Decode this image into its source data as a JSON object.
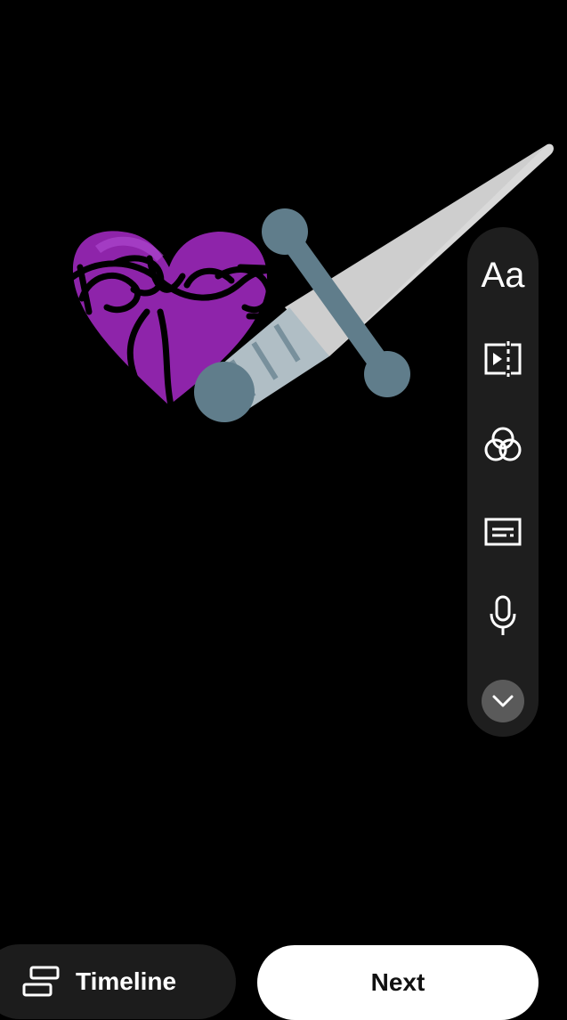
{
  "editor": {
    "sticker": {
      "icon": "purple-heart-barbed-wire-dagger",
      "heart_color": "#8e24aa",
      "blade_color": "#dcdcdc",
      "hilt_color": "#607d8b"
    }
  },
  "side_toolbar": {
    "text_tool_label": "Aa",
    "items": [
      {
        "name": "text-tool",
        "icon": "text-icon"
      },
      {
        "name": "trim-tool",
        "icon": "trim-video-icon"
      },
      {
        "name": "filters-tool",
        "icon": "filters-icon"
      },
      {
        "name": "captions-tool",
        "icon": "captions-icon"
      },
      {
        "name": "voiceover-tool",
        "icon": "microphone-icon"
      },
      {
        "name": "more-tools",
        "icon": "chevron-down-icon"
      }
    ]
  },
  "bottom_bar": {
    "timeline_label": "Timeline",
    "next_label": "Next"
  },
  "colors": {
    "background": "#000000",
    "toolbar_bg": "#1e1e1e",
    "next_bg": "#ffffff",
    "timeline_bg": "#1c1c1c"
  }
}
